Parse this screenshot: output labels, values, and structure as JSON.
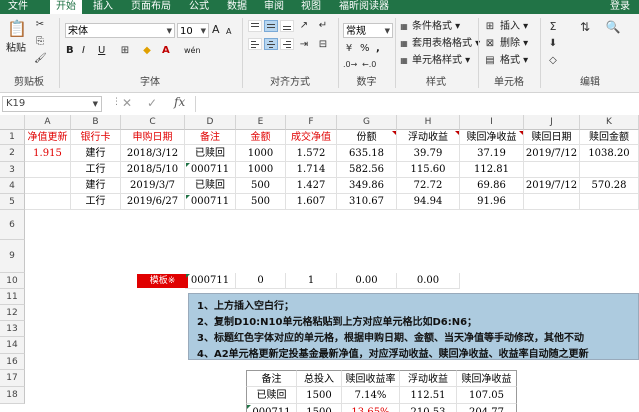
{
  "ribbon_tabs": [
    "文件",
    "开始",
    "插入",
    "页面布局",
    "公式",
    "数据",
    "审阅",
    "视图",
    "福昕阅读器"
  ],
  "login_label": "登录",
  "clipboard": {
    "paste": "粘贴",
    "group": "剪贴板"
  },
  "font": {
    "name": "宋体",
    "size": "10",
    "bold": "B",
    "italic": "I",
    "underline": "U",
    "grow": "A",
    "shrink": "A",
    "font_color": "A",
    "wen": "wén",
    "group": "字体"
  },
  "alignment": {
    "group": "对齐方式"
  },
  "number": {
    "format": "常规",
    "group": "数字",
    "pct": "%",
    "comma": ","
  },
  "styles": {
    "cond": "条件格式",
    "table": "套用表格格式",
    "cell": "单元格样式",
    "group": "样式"
  },
  "cells": {
    "insert": "插入",
    "delete": "删除",
    "format": "格式",
    "group": "单元格"
  },
  "editing": {
    "group": "编辑"
  },
  "formula_bar": {
    "name_box": "K19",
    "cancel": "✕",
    "enter": "✓",
    "fx": "fx"
  },
  "col_headers": [
    "A",
    "B",
    "C",
    "D",
    "E",
    "F",
    "G",
    "H",
    "I",
    "J",
    "K"
  ],
  "row_headers": [
    "1",
    "2",
    "3",
    "4",
    "5",
    "6",
    "9",
    "10",
    "11",
    "12",
    "13",
    "14",
    "16",
    "17",
    "18"
  ],
  "header_row": [
    "净值更新",
    "银行卡",
    "申购日期",
    "备注",
    "金额",
    "成交净值",
    "份额",
    "浮动收益",
    "赎回净收益",
    "赎回日期",
    "赎回金额"
  ],
  "rows": [
    [
      "1.915",
      "建行",
      "2018/3/12",
      "已赎回",
      "1000",
      "1.572",
      "635.18",
      "39.79",
      "37.19",
      "2019/7/12",
      "1038.20"
    ],
    [
      "",
      "工行",
      "2018/5/10",
      "000711",
      "1000",
      "1.714",
      "582.56",
      "115.60",
      "112.81",
      "",
      ""
    ],
    [
      "",
      "建行",
      "2019/3/7",
      "已赎回",
      "500",
      "1.427",
      "349.86",
      "72.72",
      "69.86",
      "2019/7/12",
      "570.28"
    ],
    [
      "",
      "工行",
      "2019/6/27",
      "000711",
      "500",
      "1.607",
      "310.67",
      "94.94",
      "91.96",
      "",
      ""
    ]
  ],
  "row10": {
    "button": "模板※",
    "d": "000711",
    "e": "0",
    "f": "1",
    "g": "0.00",
    "h": "0.00"
  },
  "notes": [
    "1、上方插入空白行；",
    "2、复制D10:N10单元格粘贴到上方对应单元格比如D6:N6；",
    "3、标题红色字体对应的单元格，根据申购日期、金额、当天净值等手动修改，其他不动",
    "4、A2单元格更新定投基金最新净值，对应浮动收益、赎回净收益、收益率自动随之更新"
  ],
  "summary": {
    "headers": [
      "备注",
      "总投入",
      "赎回收益率",
      "浮动收益",
      "赎回净收益"
    ],
    "rows": [
      [
        "已赎回",
        "1500",
        "7.14%",
        "112.51",
        "107.05"
      ],
      [
        "000711",
        "1500",
        "13.65%",
        "210.53",
        "204.77"
      ]
    ]
  },
  "colors": {
    "accent": "#217346",
    "red": "#e00000",
    "note_bg": "#adcbdf"
  }
}
